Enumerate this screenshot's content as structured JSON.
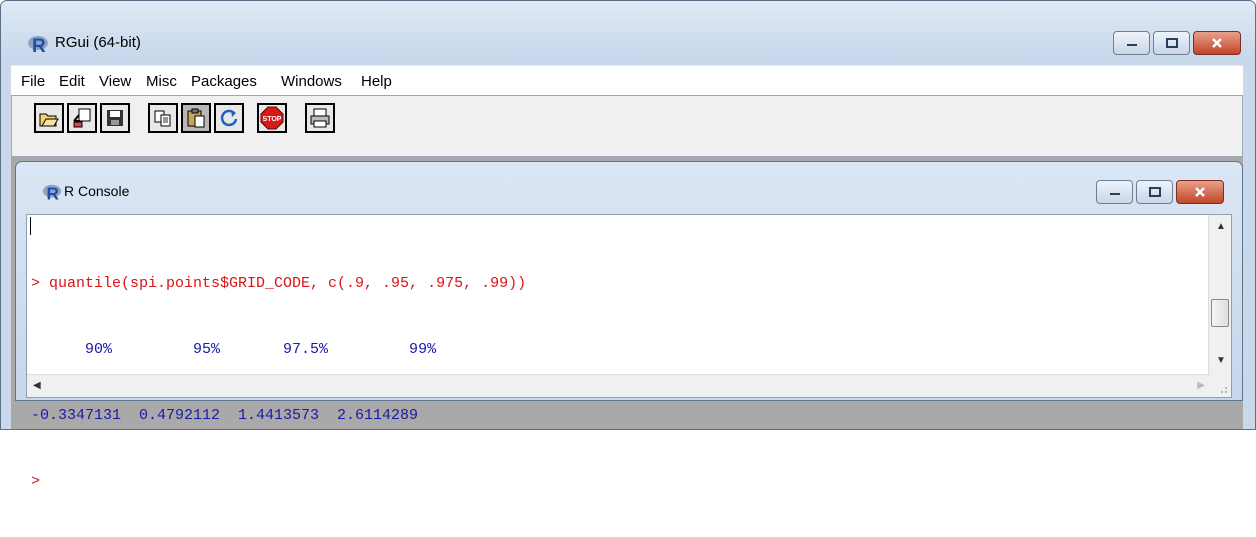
{
  "window": {
    "title": "RGui (64-bit)"
  },
  "menu": [
    "File",
    "Edit",
    "View",
    "Misc",
    "Packages",
    "Windows",
    "Help"
  ],
  "toolbar_buttons": [
    "open-script",
    "load-workspace",
    "save-workspace",
    "copy",
    "paste",
    "copy-paste",
    "stop",
    "print"
  ],
  "console": {
    "title": "R Console",
    "lines": {
      "cmd": "> quantile(spi.points$GRID_CODE, c(.9, .95, .975, .99))",
      "headers": "      90%         95%       97.5%         99%",
      "values": "-0.3347131  0.4792112  1.4413573  2.6114289",
      "prompt": ">"
    }
  },
  "colors": {
    "command": "#d81414",
    "output": "#1a1aa8"
  }
}
